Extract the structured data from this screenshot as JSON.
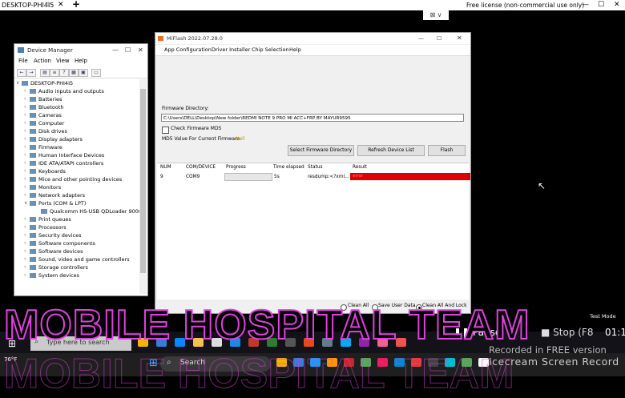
{
  "topbar": {
    "tab_title": "DESKTOP-PHI4I5",
    "license": "Free license (non-commercial use only)",
    "btn_min": "—",
    "btn_max": "☐",
    "btn_close": "✕"
  },
  "device_manager": {
    "title": "Device Manager",
    "menu": [
      "File",
      "Action",
      "View",
      "Help"
    ],
    "root": "DESKTOP-PHI4I5",
    "items": [
      "Audio inputs and outputs",
      "Batteries",
      "Bluetooth",
      "Cameras",
      "Computer",
      "Disk drives",
      "Display adapters",
      "Firmware",
      "Human Interface Devices",
      "IDE ATA/ATAPI controllers",
      "Keyboards",
      "Mice and other pointing devices",
      "Monitors",
      "Network adapters",
      "Ports (COM & LPT)",
      "Qualcomm HS-USB QDLoader 9008 (",
      "Print queues",
      "Processors",
      "Security devices",
      "Software components",
      "Software devices",
      "Sound, video and game controllers",
      "Storage controllers",
      "System devices"
    ]
  },
  "miflash": {
    "title": "MiFlash 2022.07.28.0",
    "menu": [
      "App Configuration",
      "Driver Installer",
      "Chip Selection",
      "Help"
    ],
    "firmware_label": "Firmware Directory:",
    "firmware_path": "C:\\Users\\DELL\\Desktop\\New folder\\REDMI NOTE 9 PRO MI ACC+FRP BY MAYUR9595",
    "check_md5_label": "Check Firmware MD5",
    "md5_label": "MD5 Value For Current Firmware:",
    "md5_value": "Null",
    "buttons": {
      "select": "Select Firmware Directory",
      "refresh": "Refresh Device List",
      "flash": "Flash"
    },
    "columns": [
      "NUM",
      "COM/DEVICE",
      "Progress",
      "Time elapsed",
      "Status",
      "Result"
    ],
    "row": {
      "num": "9",
      "device": "COM9",
      "progress": 0,
      "time": "5s",
      "status": "resdump:<?xml...",
      "result": "error"
    },
    "options": [
      "Clean All",
      "Save User Data",
      "Clean All And Lock"
    ],
    "selected_option": "Clean All And Lock"
  },
  "overlay": {
    "test_mode": "Test Mode",
    "banner": "MOBILE HOSPITAL TEAM",
    "pause": "Pause",
    "stop": "Stop (F8",
    "timer": "01:1",
    "recorded": "Recorded in FREE version",
    "icecream": "Icecream Screen Record"
  },
  "taskbar1": {
    "search_placeholder": "Type here to search"
  },
  "taskbar2": {
    "search_placeholder": "Search",
    "temp": "76°F"
  },
  "colors": {
    "result_error": "#e00000",
    "banner_stroke": "#e040e0",
    "md5_value": "#c8a000"
  }
}
